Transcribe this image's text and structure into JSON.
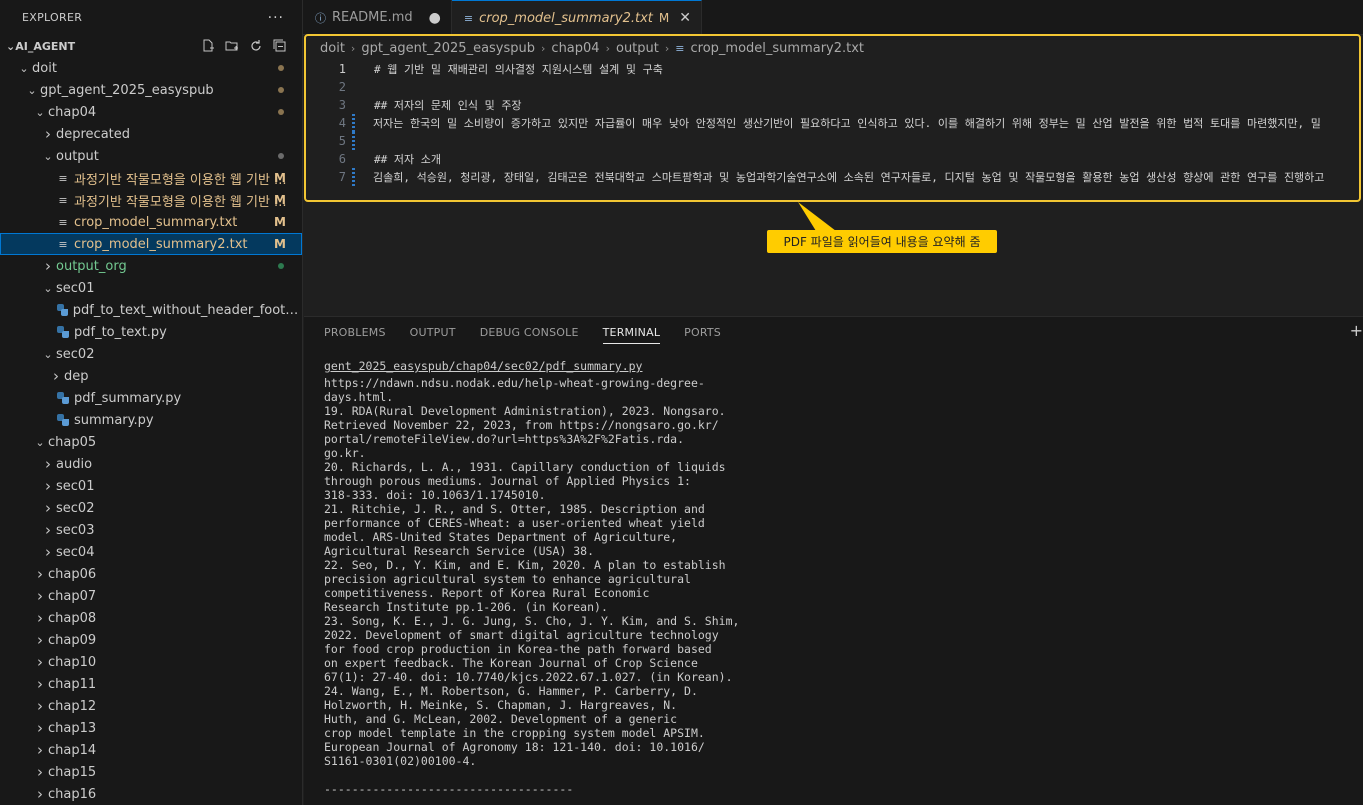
{
  "sidebar": {
    "header": "EXPLORER",
    "more": "···",
    "root": "AI_AGENT",
    "items": [
      {
        "label": "doit",
        "level": 1,
        "type": "folder-open",
        "status": "dot-mod"
      },
      {
        "label": "gpt_agent_2025_easyspub",
        "level": 2,
        "type": "folder-open",
        "status": "dot-mod"
      },
      {
        "label": "chap04",
        "level": 3,
        "type": "folder-open",
        "status": "dot-mod"
      },
      {
        "label": "deprecated",
        "level": 4,
        "type": "folder"
      },
      {
        "label": "output",
        "level": 4,
        "type": "folder-open",
        "status": "dot-gray"
      },
      {
        "label": "과정기반 작물모형을 이용한 웹 기반 ...",
        "level": 5,
        "type": "file",
        "status": "M"
      },
      {
        "label": "과정기반 작물모형을 이용한 웹 기반 ...",
        "level": 5,
        "type": "file",
        "status": "M"
      },
      {
        "label": "crop_model_summary.txt",
        "level": 5,
        "type": "file",
        "status": "M"
      },
      {
        "label": "crop_model_summary2.txt",
        "level": 5,
        "type": "file",
        "status": "M",
        "selected": true
      },
      {
        "label": "output_org",
        "level": 4,
        "type": "folder",
        "status": "dot-green"
      },
      {
        "label": "sec01",
        "level": 4,
        "type": "folder-open"
      },
      {
        "label": "pdf_to_text_without_header_footer.py",
        "level": 5,
        "type": "py"
      },
      {
        "label": "pdf_to_text.py",
        "level": 5,
        "type": "py"
      },
      {
        "label": "sec02",
        "level": 4,
        "type": "folder-open"
      },
      {
        "label": "dep",
        "level": 5,
        "type": "folder"
      },
      {
        "label": "pdf_summary.py",
        "level": 5,
        "type": "py"
      },
      {
        "label": "summary.py",
        "level": 5,
        "type": "py"
      },
      {
        "label": "chap05",
        "level": 3,
        "type": "folder-open"
      },
      {
        "label": "audio",
        "level": 4,
        "type": "folder"
      },
      {
        "label": "sec01",
        "level": 4,
        "type": "folder"
      },
      {
        "label": "sec02",
        "level": 4,
        "type": "folder"
      },
      {
        "label": "sec03",
        "level": 4,
        "type": "folder"
      },
      {
        "label": "sec04",
        "level": 4,
        "type": "folder"
      },
      {
        "label": "chap06",
        "level": 3,
        "type": "folder"
      },
      {
        "label": "chap07",
        "level": 3,
        "type": "folder"
      },
      {
        "label": "chap08",
        "level": 3,
        "type": "folder"
      },
      {
        "label": "chap09",
        "level": 3,
        "type": "folder"
      },
      {
        "label": "chap10",
        "level": 3,
        "type": "folder"
      },
      {
        "label": "chap11",
        "level": 3,
        "type": "folder"
      },
      {
        "label": "chap12",
        "level": 3,
        "type": "folder"
      },
      {
        "label": "chap13",
        "level": 3,
        "type": "folder"
      },
      {
        "label": "chap14",
        "level": 3,
        "type": "folder"
      },
      {
        "label": "chap15",
        "level": 3,
        "type": "folder"
      },
      {
        "label": "chap16",
        "level": 3,
        "type": "folder"
      }
    ]
  },
  "tabs": {
    "readme": {
      "label": "README.md"
    },
    "summary": {
      "label": "crop_model_summary2.txt",
      "status": "M"
    }
  },
  "breadcrumb": [
    "doit",
    "gpt_agent_2025_easyspub",
    "chap04",
    "output",
    "crop_model_summary2.txt"
  ],
  "editor": {
    "lines": [
      {
        "n": "1",
        "text": "# 웹 기반 밀 재배관리 의사결정 지원시스템 설계 및 구축",
        "mod": false
      },
      {
        "n": "2",
        "text": "",
        "mod": false
      },
      {
        "n": "3",
        "text": "## 저자의 문제 인식 및 주장",
        "mod": false
      },
      {
        "n": "4",
        "text": "저자는 한국의 밀 소비량이 증가하고 있지만 자급률이 매우 낮아 안정적인 생산기반이 필요하다고 인식하고 있다. 이를 해결하기 위해 정부는 밀 산업 발전을 위한 법적 토대를 마련했지만, 밀",
        "mod": true
      },
      {
        "n": "5",
        "text": "",
        "mod": true
      },
      {
        "n": "6",
        "text": "## 저자 소개",
        "mod": false
      },
      {
        "n": "7",
        "text": "김솔희, 석승원, 청리광, 장태일, 김태곤은 전북대학교 스마트팜학과 및 농업과학기술연구소에 소속된 연구자들로, 디지털 농업 및 작물모형을 활용한 농업 생산성 향상에 관한 연구를 진행하고",
        "mod": true
      }
    ]
  },
  "callout": "PDF 파일을 읽어들여 내용을 요약해 줌",
  "panel": {
    "tabs": [
      "PROBLEMS",
      "OUTPUT",
      "DEBUG CONSOLE",
      "TERMINAL",
      "PORTS"
    ],
    "active": "TERMINAL",
    "terminal": [
      "gent_2025_easyspub/chap04/sec02/pdf_summary.py",
      "https://ndawn.ndsu.nodak.edu/help-wheat-growing-degree-",
      "days.html.",
      "19. RDA(Rural Development Administration), 2023. Nongsaro.",
      "Retrieved November 22, 2023, from https://nongsaro.go.kr/",
      "portal/remoteFileView.do?url=https%3A%2F%2Fatis.rda.",
      "go.kr.",
      "20. Richards, L. A., 1931. Capillary conduction of liquids",
      "through porous mediums. Journal of Applied Physics 1:",
      "318-333. doi: 10.1063/1.1745010.",
      "21. Ritchie, J. R., and S. Otter, 1985. Description and",
      "performance of CERES-Wheat: a user-oriented wheat yield",
      "model. ARS-United States Department of Agriculture,",
      "Agricultural Research Service (USA) 38.",
      "22. Seo, D., Y. Kim, and E. Kim, 2020. A plan to establish",
      "precision agricultural system to enhance agricultural",
      "competitiveness. Report of Korea Rural Economic",
      "Research Institute pp.1-206. (in Korean).",
      "23. Song, K. E., J. G. Jung, S. Cho, J. Y. Kim, and S. Shim,",
      "2022. Development of smart digital agriculture technology",
      "for food crop production in Korea-the path forward based",
      "on expert feedback. The Korean Journal of Crop Science",
      "67(1): 27-40. doi: 10.7740/kjcs.2022.67.1.027. (in Korean).",
      "24. Wang, E., M. Robertson, G. Hammer, P. Carberry, D.",
      "Holzworth, H. Meinke, S. Chapman, J. Hargreaves, N.",
      "Huth, and G. McLean, 2002. Development of a generic",
      "crop model template in the cropping system model APSIM.",
      "European Journal of Agronomy 18: 121-140. doi: 10.1016/",
      "S1161-0301(02)00100-4.",
      "",
      "------------------------------------"
    ]
  },
  "colors": {
    "accent": "#0078d4",
    "modified": "#e2c08d",
    "untracked": "#73c991",
    "highlight": "#f2c633",
    "callout": "#ffcc00"
  }
}
